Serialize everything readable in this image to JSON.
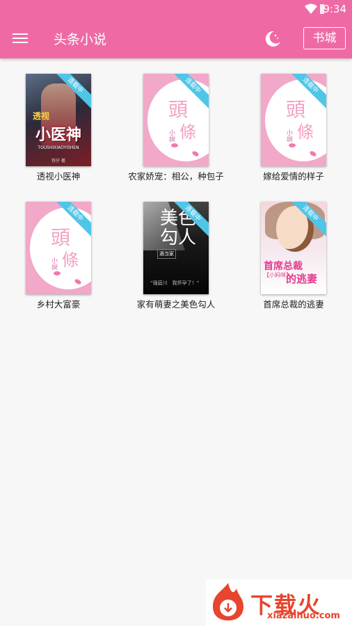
{
  "status_bar": {
    "time": "9:34"
  },
  "app_bar": {
    "title": "头条小说",
    "store_label": "书城"
  },
  "ribbon_label": "连载中",
  "default_cover": {
    "big1": "頭",
    "big2": "條",
    "small": "小說"
  },
  "books": [
    {
      "name": "透视小医神",
      "cover_title": "小医神",
      "cover_title_top": "透视",
      "cover_en": "TOUSHIXIAOYISHEN",
      "cover_author": "铁仔 著"
    },
    {
      "name": "农家娇宠：相公，种包子"
    },
    {
      "name": "嫁给爱情的样子"
    },
    {
      "name": "乡村大富豪"
    },
    {
      "name": "家有萌妻之美色勾人",
      "cover_title": "美色勾人",
      "cover_author": "酒当家",
      "cover_line": "“强庭川　我怀孕了！”"
    },
    {
      "name": "首席总裁的逃妻",
      "cover_title": "首席总裁",
      "cover_sub": "【小妈咪】",
      "cover_title2": "的逃妻"
    }
  ],
  "watermark": {
    "text": "下载火",
    "url": "xiazaihuo.com"
  },
  "colors": {
    "primary": "#ef6aa4",
    "ribbon": "#4fc6e8",
    "watermark": "#e7452e"
  }
}
